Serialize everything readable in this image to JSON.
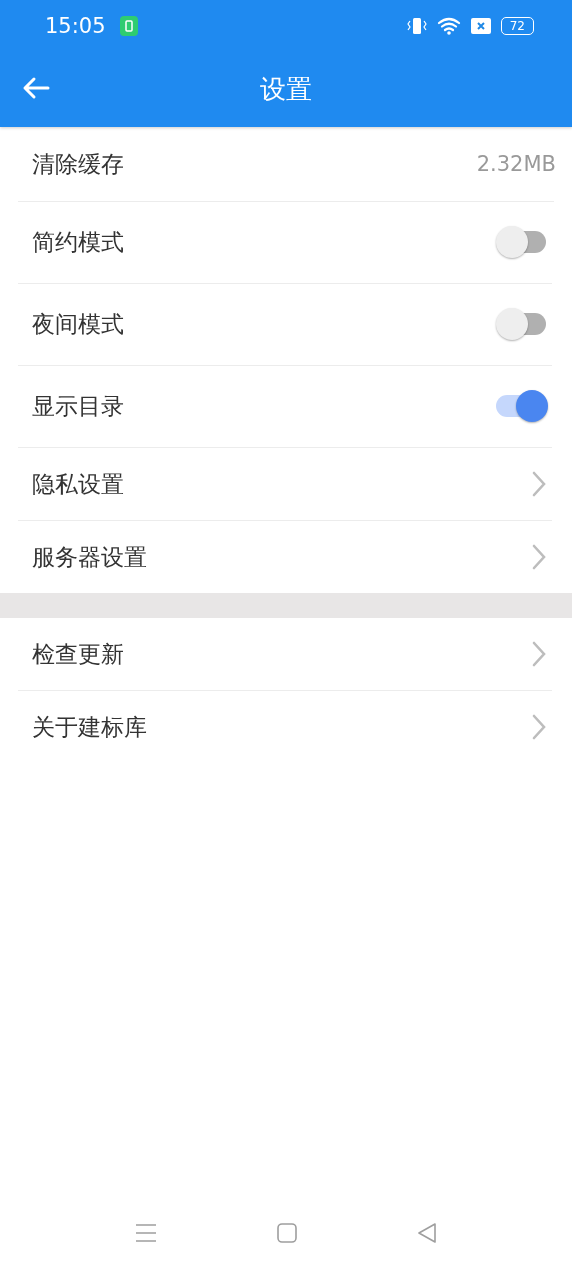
{
  "status_bar": {
    "time": "15:05",
    "battery": "72"
  },
  "app_bar": {
    "title": "设置"
  },
  "sections": [
    {
      "rows": [
        {
          "kind": "value",
          "label": "清除缓存",
          "value": "2.32MB"
        },
        {
          "kind": "toggle",
          "label": "简约模式",
          "on": false
        },
        {
          "kind": "toggle",
          "label": "夜间模式",
          "on": false
        },
        {
          "kind": "toggle",
          "label": "显示目录",
          "on": true
        },
        {
          "kind": "link",
          "label": "隐私设置"
        },
        {
          "kind": "link",
          "label": "服务器设置"
        }
      ]
    },
    {
      "rows": [
        {
          "kind": "link",
          "label": "检查更新"
        },
        {
          "kind": "link",
          "label": "关于建标库"
        }
      ]
    }
  ]
}
